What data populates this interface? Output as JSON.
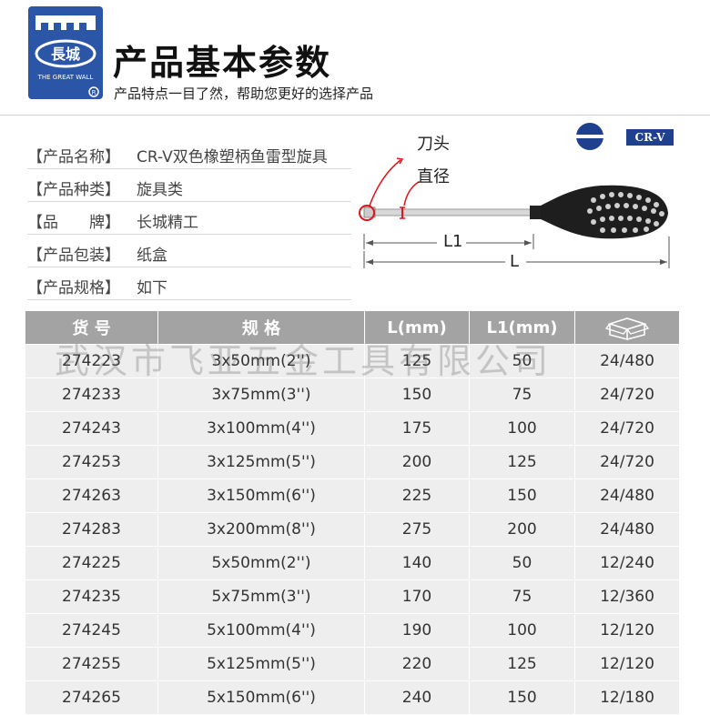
{
  "header": {
    "logo_text_cn": "長城",
    "logo_text_en": "THE GREAT WALL",
    "title": "产品基本参数",
    "subtitle": "产品特点一目了然，帮助您更好的选择产品"
  },
  "info": [
    {
      "label": "【产品名称】",
      "value": "CR-V双色橡塑柄鱼雷型旋具"
    },
    {
      "label": "【产品种类】",
      "value": "旋具类"
    },
    {
      "label": "【品　　牌】",
      "value": "长城精工"
    },
    {
      "label": "【产品包装】",
      "value": "纸盒"
    },
    {
      "label": "【产品规格】",
      "value": "如下"
    }
  ],
  "badges": {
    "crv": "CR-V",
    "slot_icon": "slotted-tip-icon"
  },
  "diagram": {
    "tip_label": "刀头",
    "diameter_label": "直径",
    "l1_label": "L1",
    "l_label": "L"
  },
  "table": {
    "headers": [
      "货 号",
      "规  格",
      "L(mm)",
      "L1(mm)"
    ],
    "carton_icon": "carton-box-icon",
    "rows": [
      [
        "274223",
        "3x50mm(2'')",
        "125",
        "50",
        "24/480"
      ],
      [
        "274233",
        "3x75mm(3'')",
        "150",
        "75",
        "24/720"
      ],
      [
        "274243",
        "3x100mm(4'')",
        "175",
        "100",
        "24/720"
      ],
      [
        "274253",
        "3x125mm(5'')",
        "200",
        "125",
        "24/720"
      ],
      [
        "274263",
        "3x150mm(6'')",
        "225",
        "150",
        "24/480"
      ],
      [
        "274283",
        "3x200mm(8'')",
        "275",
        "200",
        "24/480"
      ],
      [
        "274225",
        "5x50mm(2'')",
        "140",
        "50",
        "12/240"
      ],
      [
        "274235",
        "5x75mm(3'')",
        "170",
        "75",
        "12/360"
      ],
      [
        "274245",
        "5x100mm(4'')",
        "190",
        "100",
        "12/120"
      ],
      [
        "274255",
        "5x125mm(5'')",
        "220",
        "125",
        "12/120"
      ],
      [
        "274265",
        "5x150mm(6'')",
        "240",
        "150",
        "12/180"
      ]
    ]
  },
  "watermark": "武汉市飞亚五金工具有限公司",
  "colors": {
    "brand_blue": "#2b55a6",
    "accent_red": "#e0141b",
    "table_header": "#a3a3a3",
    "table_row": "#eeeeee"
  }
}
